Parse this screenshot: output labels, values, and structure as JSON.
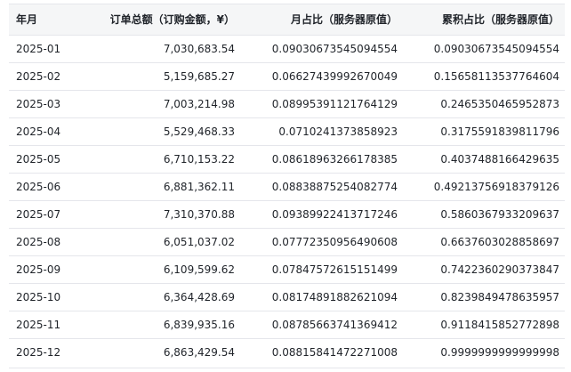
{
  "table": {
    "columns": [
      "年月",
      "订单总额（订购金额，¥）",
      "月占比（服务器原值）",
      "累积占比（服务器原值）"
    ],
    "rows": [
      [
        "2025-01",
        "7,030,683.54",
        "0.09030673545094554",
        "0.09030673545094554"
      ],
      [
        "2025-02",
        "5,159,685.27",
        "0.06627439992670049",
        "0.15658113537764604"
      ],
      [
        "2025-03",
        "7,003,214.98",
        "0.08995391121764129",
        "0.2465350465952873"
      ],
      [
        "2025-04",
        "5,529,468.33",
        "0.0710241373858923",
        "0.3175591839811796"
      ],
      [
        "2025-05",
        "6,710,153.22",
        "0.08618963266178385",
        "0.4037488166429635"
      ],
      [
        "2025-06",
        "6,881,362.11",
        "0.08838875254082774",
        "0.49213756918379126"
      ],
      [
        "2025-07",
        "7,310,370.88",
        "0.09389922413717246",
        "0.5860367933209637"
      ],
      [
        "2025-08",
        "6,051,037.02",
        "0.07772350956490608",
        "0.6637603028858697"
      ],
      [
        "2025-09",
        "6,109,599.62",
        "0.07847572615151499",
        "0.7422360290373847"
      ],
      [
        "2025-10",
        "6,364,428.69",
        "0.08174891882621094",
        "0.8239849478635957"
      ],
      [
        "2025-11",
        "6,839,935.16",
        "0.08785663741369412",
        "0.9118415852772898"
      ],
      [
        "2025-12",
        "6,863,429.54",
        "0.08815841472271008",
        "0.9999999999999998"
      ]
    ]
  }
}
